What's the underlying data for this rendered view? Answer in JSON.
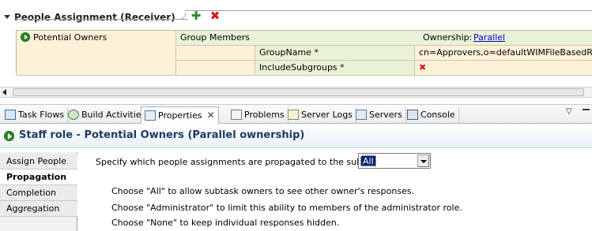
{
  "section": {
    "title": "People Assignment (Receiver)",
    "add_icon": "plus-icon",
    "delete_icon": "delete-x-icon"
  },
  "grid": {
    "potential_owners": "Potential Owners",
    "group_members": "Group Members",
    "ownership_label": "Ownership:",
    "ownership_value": "Parallel",
    "params": [
      {
        "name": "GroupName *",
        "value": "cn=Approvers,o=defaultWIMFileBasedRealm"
      },
      {
        "name": "IncludeSubgroups *",
        "value": "✖"
      }
    ]
  },
  "tabs": [
    {
      "label": "Task Flows",
      "icon": "task-flows-icon"
    },
    {
      "label": "Build Activities",
      "icon": "build-activities-icon"
    },
    {
      "label": "Properties",
      "icon": "properties-icon",
      "close": "✕",
      "active": true
    },
    {
      "label": "Problems",
      "icon": "problems-icon"
    },
    {
      "label": "Server Logs",
      "icon": "server-logs-icon"
    },
    {
      "label": "Servers",
      "icon": "servers-icon"
    },
    {
      "label": "Console",
      "icon": "console-icon"
    }
  ],
  "view_menu": "▽",
  "properties": {
    "title": "Staff role - Potential Owners (Parallel ownership)",
    "side_tabs": [
      "Assign People",
      "Propagation",
      "Completion",
      "Aggregation"
    ],
    "active_side_tab": "Propagation",
    "instruction": "Specify which people assignments are propagated to the subtasks:",
    "select_value": "All",
    "notes": [
      "Choose \"All\" to allow subtask owners to see other owner's responses.",
      "Choose \"Administrator\" to limit this ability to members of the administrator role.",
      "Choose \"None\" to keep individual responses hidden."
    ]
  },
  "colors": {
    "owner_cell": "#fdf2d8",
    "member_cell": "#e9f2d6",
    "header_title": "#1d3a66",
    "link": "#0000cc",
    "delete": "#d41a1a",
    "add": "#2a8a2a"
  }
}
